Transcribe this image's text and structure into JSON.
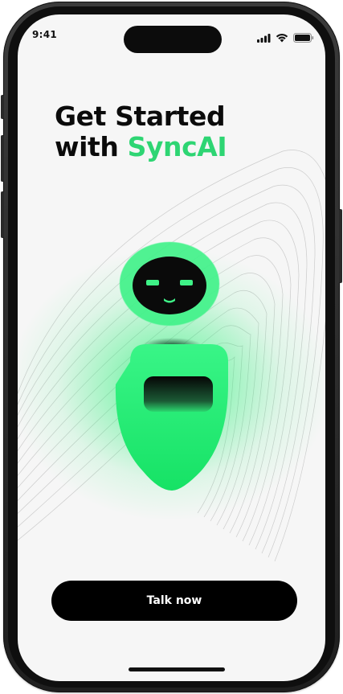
{
  "status_bar": {
    "time": "9:41",
    "icons": [
      "signal-icon",
      "wifi-icon",
      "battery-icon"
    ]
  },
  "headline": {
    "line1": "Get Started",
    "line2_prefix": "with",
    "line2_accent": "SyncAI"
  },
  "cta": {
    "label": "Talk now"
  },
  "colors": {
    "accent": "#2ed573",
    "robot_green": "#2cf076",
    "background": "#f6f6f6",
    "button": "#000000"
  },
  "illustration": {
    "icon": "ai-robot-icon"
  }
}
